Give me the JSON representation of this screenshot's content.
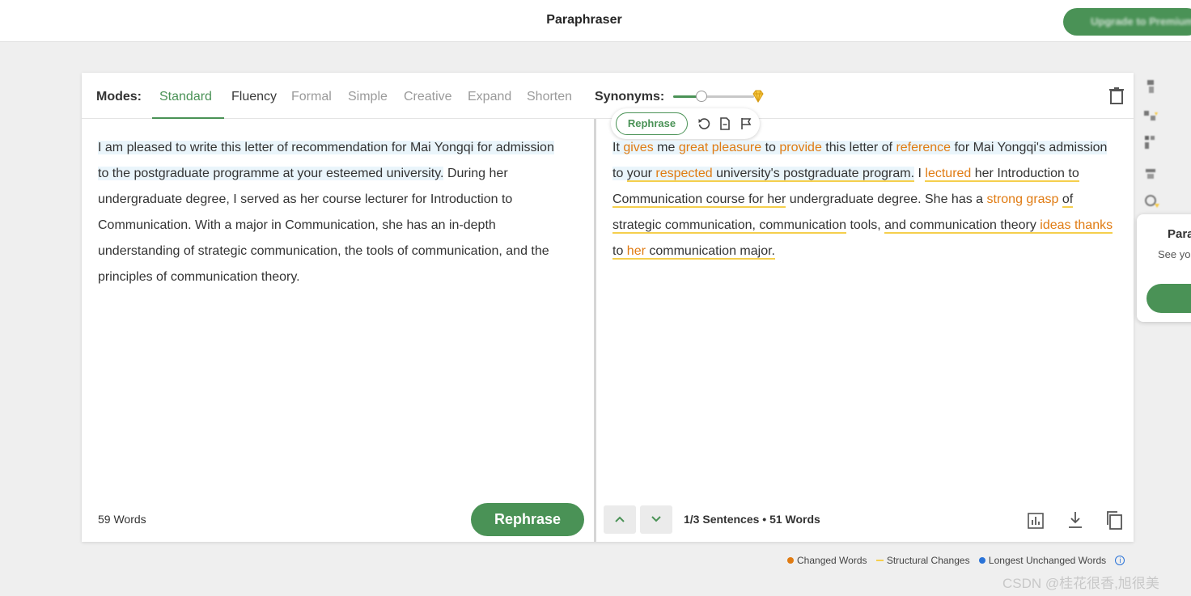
{
  "header": {
    "title": "Paraphraser",
    "upgrade_label": "Upgrade to Premium"
  },
  "toolbar": {
    "modes_label": "Modes:",
    "modes": [
      "Standard",
      "Fluency",
      "Formal",
      "Simple",
      "Creative",
      "Expand",
      "Shorten"
    ],
    "active_mode": "Standard",
    "synonyms_label": "Synonyms:",
    "synonyms_level": 0.35
  },
  "input": {
    "highlighted": "I am pleased to write this letter of recommendation for Mai Yongqi for admission to the postgraduate programme at your esteemed university.",
    "rest": "During her undergraduate degree, I served as her course lecturer for Introduction to Communication. With a major in Communication, she has an in-depth understanding of strategic communication, the tools of communication, and the principles of communication theory.",
    "word_count": "59 Words",
    "rephrase_label": "Rephrase"
  },
  "output": {
    "sentence_popup": {
      "rephrase_label": "Rephrase"
    },
    "segments": [
      {
        "t": "It ",
        "c": "u",
        "s": false,
        "h": true
      },
      {
        "t": "gives",
        "c": "ch",
        "s": false,
        "h": true
      },
      {
        "t": " me ",
        "c": "u",
        "s": false,
        "h": true
      },
      {
        "t": "great pleasure",
        "c": "ch",
        "s": false,
        "h": true
      },
      {
        "t": " to ",
        "c": "u",
        "s": false,
        "h": true
      },
      {
        "t": "provide",
        "c": "ch",
        "s": false,
        "h": true
      },
      {
        "t": " this letter of ",
        "c": "u",
        "s": false,
        "h": true
      },
      {
        "t": "reference",
        "c": "ch",
        "s": false,
        "h": true
      },
      {
        "t": " for Mai Yongqi's admission to ",
        "c": "u",
        "s": false,
        "h": true
      },
      {
        "t": "your ",
        "c": "u",
        "s": true,
        "h": true
      },
      {
        "t": "respected",
        "c": "ch",
        "s": true,
        "h": true
      },
      {
        "t": " university's postgraduate program.",
        "c": "u",
        "s": true,
        "h": true
      },
      {
        "t": " I ",
        "c": "u",
        "s": false,
        "h": false
      },
      {
        "t": "lectured",
        "c": "ch",
        "s": true,
        "h": false
      },
      {
        "t": " her ",
        "c": "u",
        "s": true,
        "h": false
      },
      {
        "t": "Introduction to Communication course for her",
        "c": "u",
        "s": true,
        "h": false
      },
      {
        "t": " undergraduate degree. She has a ",
        "c": "u",
        "s": false,
        "h": false
      },
      {
        "t": "strong grasp",
        "c": "ch",
        "s": false,
        "h": false
      },
      {
        "t": " ",
        "c": "u",
        "s": false,
        "h": false
      },
      {
        "t": "of strategic communication, communication",
        "c": "u",
        "s": true,
        "h": false
      },
      {
        "t": " tools, ",
        "c": "u",
        "s": false,
        "h": false
      },
      {
        "t": "and communication theory ",
        "c": "u",
        "s": true,
        "h": false
      },
      {
        "t": "ideas thanks",
        "c": "ch",
        "s": true,
        "h": false
      },
      {
        "t": " to ",
        "c": "u",
        "s": true,
        "h": false
      },
      {
        "t": "her",
        "c": "ch",
        "s": true,
        "h": false
      },
      {
        "t": " communication major.",
        "c": "u",
        "s": true,
        "h": false
      }
    ],
    "sentence_info": "1/3 Sentences • 51 Words"
  },
  "legend": {
    "changed": "Changed Words",
    "structural": "Structural Changes",
    "longest": "Longest Unchanged Words",
    "colors": {
      "changed": "#e07b12",
      "structural": "#f5cf4d",
      "longest": "#2a73d8"
    }
  },
  "side_panel": {
    "title": "Para",
    "subtitle": "See yo"
  },
  "watermark": "CSDN @桂花很香,旭很美",
  "colors": {
    "accent": "#4a9256",
    "changed": "#e07b12",
    "structural": "#f5cf4d"
  }
}
